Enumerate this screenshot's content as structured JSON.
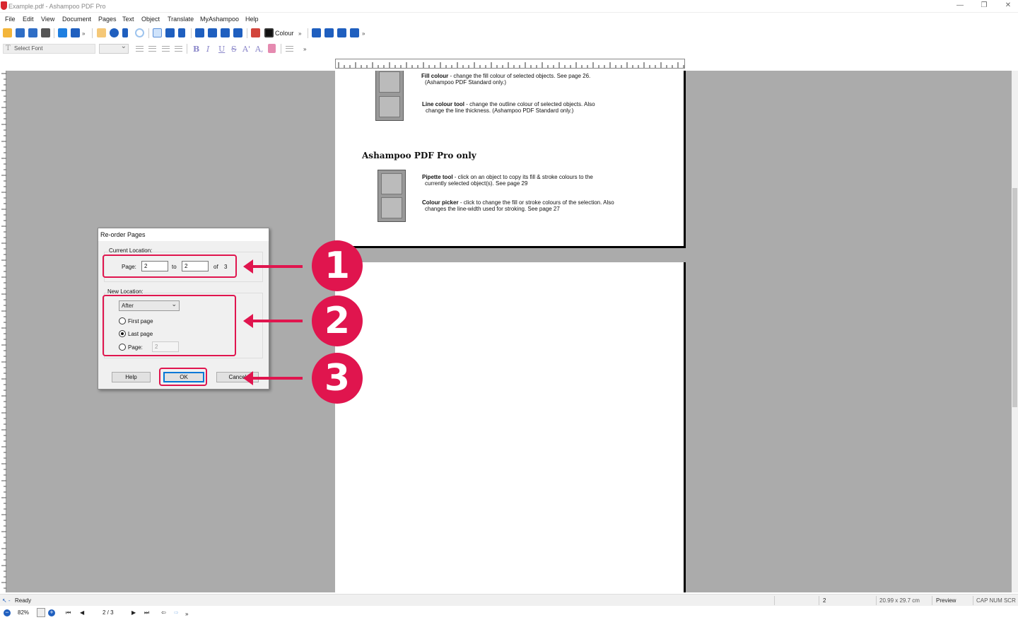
{
  "window": {
    "title": "Example.pdf - Ashampoo PDF Pro",
    "controls": {
      "minimize": "—",
      "restore": "❐",
      "close": "✕"
    }
  },
  "menu": [
    "File",
    "Edit",
    "View",
    "Document",
    "Pages",
    "Text",
    "Object",
    "Translate",
    "MyAshampoo",
    "Help"
  ],
  "toolbar": {
    "colour_label": "Colour",
    "font_placeholder": "Select Font",
    "more": "»",
    "format_buttons": [
      "B",
      "I",
      "U",
      "S",
      "A'",
      "A,"
    ]
  },
  "page_content": {
    "fill_colour_title": "Fill colour",
    "fill_colour_desc": "- change the fill colour of selected objects.  See page 26.",
    "fill_colour_desc2": "(Ashampoo PDF Standard only.)",
    "line_colour_title": "Line colour tool",
    "line_colour_desc": "- change the outline colour of selected objects. Also",
    "line_colour_desc2": "change the line thickness. (Ashampoo PDF Standard only.)",
    "section_heading": "Ashampoo PDF Pro only",
    "pipette_title": "Pipette tool",
    "pipette_desc": "- click on an object to copy its fill & stroke colours to the",
    "pipette_desc2": "currently selected object(s). See page 29",
    "colour_picker_title": "Colour picker",
    "colour_picker_desc": "- click to change the fill or stroke colours of the selection. Also",
    "colour_picker_desc2": "changes the line-width used for stroking. See page 27"
  },
  "dialog": {
    "title": "Re-order Pages",
    "current_location_label": "Current Location:",
    "page_label": "Page:",
    "from_value": "2",
    "to_label": "to",
    "to_value": "2",
    "of_label": "of",
    "total_pages": "3",
    "new_location_label": "New Location:",
    "position_select": "After",
    "radio_first": "First page",
    "radio_last": "Last page",
    "radio_page": "Page:",
    "page_value": "2",
    "selected_radio": "last",
    "buttons": {
      "help": "Help",
      "ok": "OK",
      "cancel": "Cancel"
    }
  },
  "annotations": [
    "1",
    "2",
    "3"
  ],
  "colors": {
    "accent": "#e0154e",
    "workspace": "#ababab",
    "primary_blue": "#0078d7"
  },
  "status": {
    "ready": "Ready",
    "page": "2",
    "paper_size": "20.99 x 29.7 cm",
    "mode": "Preview",
    "indicators": "CAP  NUM  SCR"
  },
  "nav": {
    "zoom": "82%",
    "page_indicator": "2 / 3"
  }
}
